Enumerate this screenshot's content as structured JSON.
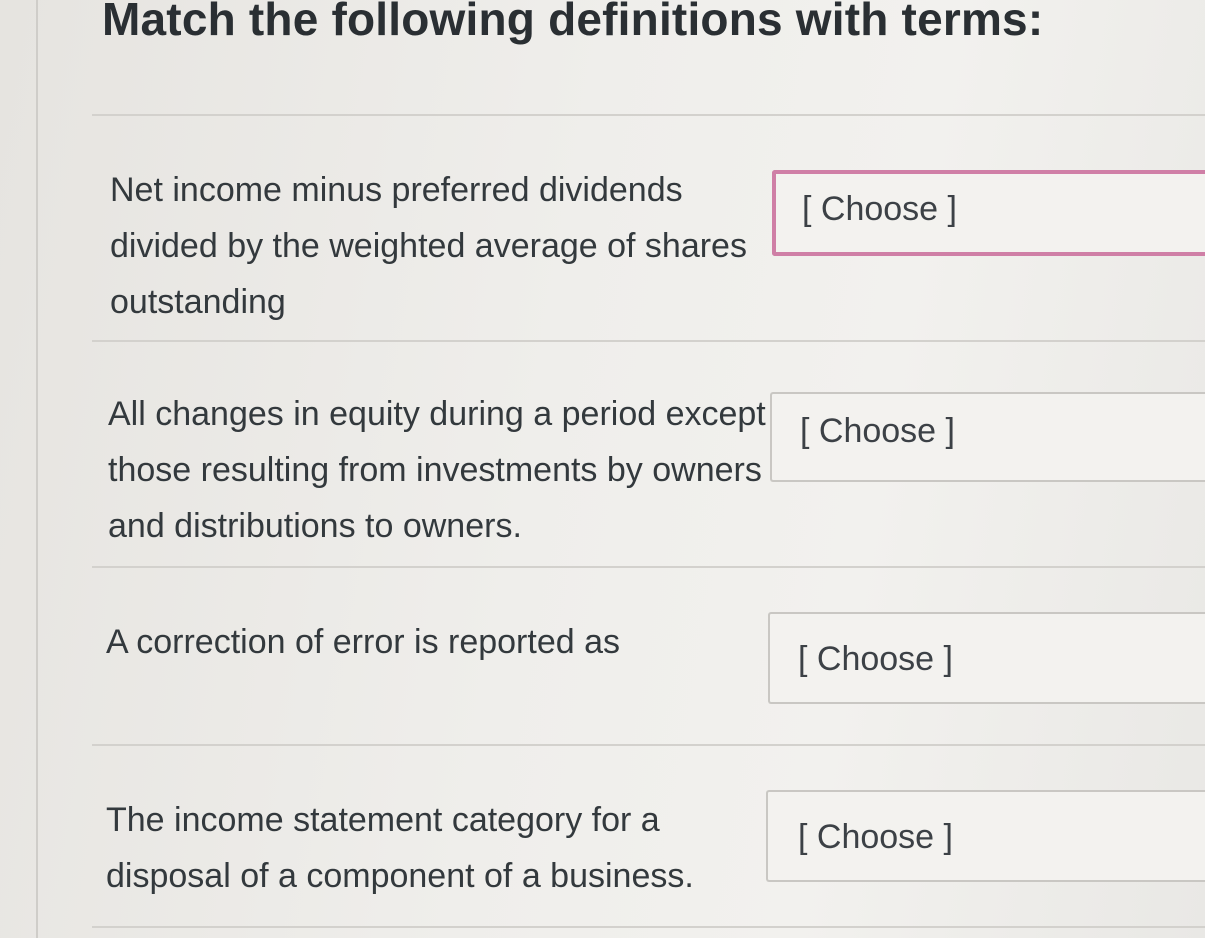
{
  "quiz": {
    "title": "Match the following definitions with terms:",
    "select_placeholder": "[ Choose ]",
    "rows": [
      {
        "definition": "Net income minus preferred dividends divided by the weighted average of shares outstanding",
        "selected": "[ Choose ]",
        "focused": true
      },
      {
        "definition": "All changes in equity during a period except those resulting from investments by owners and distributions to owners.",
        "selected": "[ Choose ]",
        "focused": false
      },
      {
        "definition": "A correction of error is reported as",
        "selected": "[ Choose ]",
        "focused": false
      },
      {
        "definition": "The income statement category for a disposal of a component of a business.",
        "selected": "[ Choose ]",
        "focused": false
      }
    ]
  },
  "colors": {
    "focus_border": "#cf7fa6",
    "text": "#33393d",
    "divider": "#d3d1cd"
  }
}
